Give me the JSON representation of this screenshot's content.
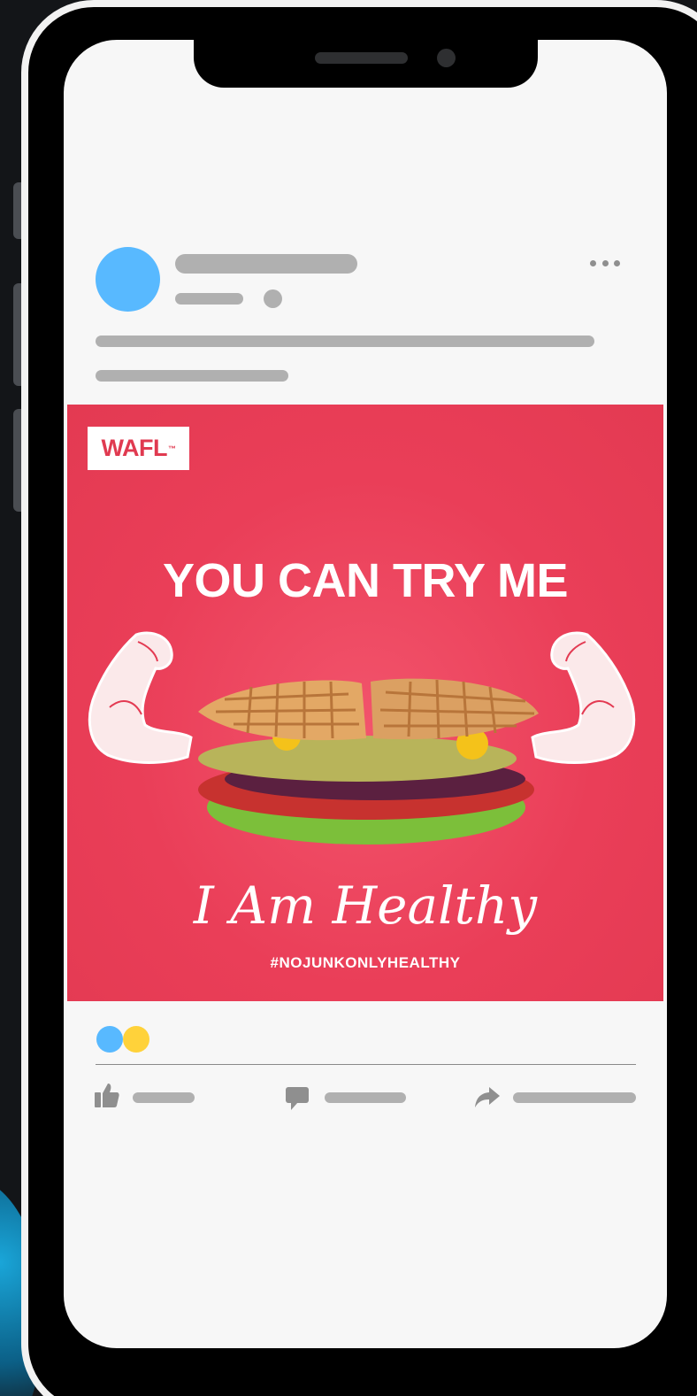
{
  "ad": {
    "brand": "WAFL",
    "brand_mark": "™",
    "headline": "YOU CAN TRY ME",
    "tagline": "I Am Healthy",
    "hashtag": "#NOJUNKONLYHEALTHY"
  },
  "colors": {
    "ad_background": "#ea3e58",
    "avatar": "#58b9ff",
    "reaction_like": "#58b9ff",
    "reaction_love": "#ffd23a",
    "placeholder": "#b0b0b0",
    "icon": "#8f8f8f"
  },
  "icons": {
    "menu": "more-dots-icon",
    "like": "thumbs-up-icon",
    "comment": "comment-icon",
    "share": "share-icon"
  }
}
